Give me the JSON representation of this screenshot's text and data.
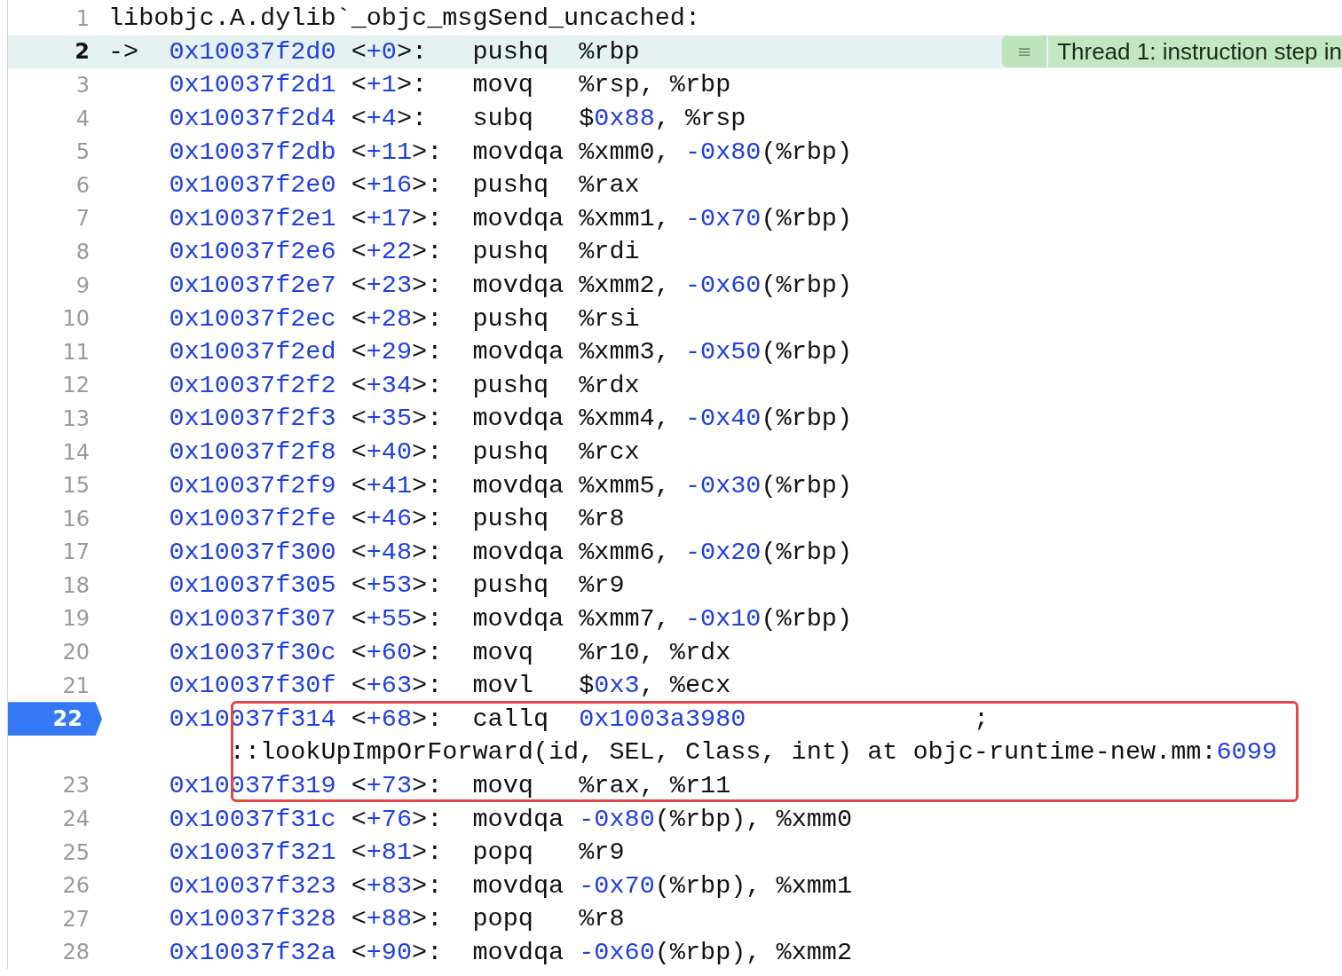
{
  "lines": [
    {
      "number": "1",
      "kind": "header",
      "current": false,
      "breakpoint": false,
      "code": [
        {
          "text": "libobjc.A.dylib`_objc_msgSend_uncached:",
          "kind": "plain"
        }
      ]
    },
    {
      "number": "2",
      "kind": "instruction",
      "current": true,
      "breakpoint": false,
      "arrow": "->",
      "badge": {
        "icon": "≡",
        "text": "Thread 1: instruction step in"
      },
      "code": [
        {
          "text": "0x10037f2d0",
          "kind": "literal"
        },
        {
          "text": " <",
          "kind": "plain"
        },
        {
          "text": "+0",
          "kind": "literal"
        },
        {
          "text": ">:   pushq  %rbp",
          "kind": "plain"
        }
      ]
    },
    {
      "number": "3",
      "kind": "instruction",
      "current": false,
      "breakpoint": false,
      "code": [
        {
          "text": "0x10037f2d1",
          "kind": "literal"
        },
        {
          "text": " <",
          "kind": "plain"
        },
        {
          "text": "+1",
          "kind": "literal"
        },
        {
          "text": ">:   movq   %rsp, %rbp",
          "kind": "plain"
        }
      ]
    },
    {
      "number": "4",
      "kind": "instruction",
      "current": false,
      "breakpoint": false,
      "code": [
        {
          "text": "0x10037f2d4",
          "kind": "literal"
        },
        {
          "text": " <",
          "kind": "plain"
        },
        {
          "text": "+4",
          "kind": "literal"
        },
        {
          "text": ">:   subq   $",
          "kind": "plain"
        },
        {
          "text": "0x88",
          "kind": "literal"
        },
        {
          "text": ", %rsp",
          "kind": "plain"
        }
      ]
    },
    {
      "number": "5",
      "kind": "instruction",
      "current": false,
      "breakpoint": false,
      "code": [
        {
          "text": "0x10037f2db",
          "kind": "literal"
        },
        {
          "text": " <",
          "kind": "plain"
        },
        {
          "text": "+11",
          "kind": "literal"
        },
        {
          "text": ">:  movdqa %xmm0, ",
          "kind": "plain"
        },
        {
          "text": "-0x80",
          "kind": "literal"
        },
        {
          "text": "(%rbp)",
          "kind": "plain"
        }
      ]
    },
    {
      "number": "6",
      "kind": "instruction",
      "current": false,
      "breakpoint": false,
      "code": [
        {
          "text": "0x10037f2e0",
          "kind": "literal"
        },
        {
          "text": " <",
          "kind": "plain"
        },
        {
          "text": "+16",
          "kind": "literal"
        },
        {
          "text": ">:  pushq  %rax",
          "kind": "plain"
        }
      ]
    },
    {
      "number": "7",
      "kind": "instruction",
      "current": false,
      "breakpoint": false,
      "code": [
        {
          "text": "0x10037f2e1",
          "kind": "literal"
        },
        {
          "text": " <",
          "kind": "plain"
        },
        {
          "text": "+17",
          "kind": "literal"
        },
        {
          "text": ">:  movdqa %xmm1, ",
          "kind": "plain"
        },
        {
          "text": "-0x70",
          "kind": "literal"
        },
        {
          "text": "(%rbp)",
          "kind": "plain"
        }
      ]
    },
    {
      "number": "8",
      "kind": "instruction",
      "current": false,
      "breakpoint": false,
      "code": [
        {
          "text": "0x10037f2e6",
          "kind": "literal"
        },
        {
          "text": " <",
          "kind": "plain"
        },
        {
          "text": "+22",
          "kind": "literal"
        },
        {
          "text": ">:  pushq  %rdi",
          "kind": "plain"
        }
      ]
    },
    {
      "number": "9",
      "kind": "instruction",
      "current": false,
      "breakpoint": false,
      "code": [
        {
          "text": "0x10037f2e7",
          "kind": "literal"
        },
        {
          "text": " <",
          "kind": "plain"
        },
        {
          "text": "+23",
          "kind": "literal"
        },
        {
          "text": ">:  movdqa %xmm2, ",
          "kind": "plain"
        },
        {
          "text": "-0x60",
          "kind": "literal"
        },
        {
          "text": "(%rbp)",
          "kind": "plain"
        }
      ]
    },
    {
      "number": "10",
      "kind": "instruction",
      "current": false,
      "breakpoint": false,
      "code": [
        {
          "text": "0x10037f2ec",
          "kind": "literal"
        },
        {
          "text": " <",
          "kind": "plain"
        },
        {
          "text": "+28",
          "kind": "literal"
        },
        {
          "text": ">:  pushq  %rsi",
          "kind": "plain"
        }
      ]
    },
    {
      "number": "11",
      "kind": "instruction",
      "current": false,
      "breakpoint": false,
      "code": [
        {
          "text": "0x10037f2ed",
          "kind": "literal"
        },
        {
          "text": " <",
          "kind": "plain"
        },
        {
          "text": "+29",
          "kind": "literal"
        },
        {
          "text": ">:  movdqa %xmm3, ",
          "kind": "plain"
        },
        {
          "text": "-0x50",
          "kind": "literal"
        },
        {
          "text": "(%rbp)",
          "kind": "plain"
        }
      ]
    },
    {
      "number": "12",
      "kind": "instruction",
      "current": false,
      "breakpoint": false,
      "code": [
        {
          "text": "0x10037f2f2",
          "kind": "literal"
        },
        {
          "text": " <",
          "kind": "plain"
        },
        {
          "text": "+34",
          "kind": "literal"
        },
        {
          "text": ">:  pushq  %rdx",
          "kind": "plain"
        }
      ]
    },
    {
      "number": "13",
      "kind": "instruction",
      "current": false,
      "breakpoint": false,
      "code": [
        {
          "text": "0x10037f2f3",
          "kind": "literal"
        },
        {
          "text": " <",
          "kind": "plain"
        },
        {
          "text": "+35",
          "kind": "literal"
        },
        {
          "text": ">:  movdqa %xmm4, ",
          "kind": "plain"
        },
        {
          "text": "-0x40",
          "kind": "literal"
        },
        {
          "text": "(%rbp)",
          "kind": "plain"
        }
      ]
    },
    {
      "number": "14",
      "kind": "instruction",
      "current": false,
      "breakpoint": false,
      "code": [
        {
          "text": "0x10037f2f8",
          "kind": "literal"
        },
        {
          "text": " <",
          "kind": "plain"
        },
        {
          "text": "+40",
          "kind": "literal"
        },
        {
          "text": ">:  pushq  %rcx",
          "kind": "plain"
        }
      ]
    },
    {
      "number": "15",
      "kind": "instruction",
      "current": false,
      "breakpoint": false,
      "code": [
        {
          "text": "0x10037f2f9",
          "kind": "literal"
        },
        {
          "text": " <",
          "kind": "plain"
        },
        {
          "text": "+41",
          "kind": "literal"
        },
        {
          "text": ">:  movdqa %xmm5, ",
          "kind": "plain"
        },
        {
          "text": "-0x30",
          "kind": "literal"
        },
        {
          "text": "(%rbp)",
          "kind": "plain"
        }
      ]
    },
    {
      "number": "16",
      "kind": "instruction",
      "current": false,
      "breakpoint": false,
      "code": [
        {
          "text": "0x10037f2fe",
          "kind": "literal"
        },
        {
          "text": " <",
          "kind": "plain"
        },
        {
          "text": "+46",
          "kind": "literal"
        },
        {
          "text": ">:  pushq  %r8",
          "kind": "plain"
        }
      ]
    },
    {
      "number": "17",
      "kind": "instruction",
      "current": false,
      "breakpoint": false,
      "code": [
        {
          "text": "0x10037f300",
          "kind": "literal"
        },
        {
          "text": " <",
          "kind": "plain"
        },
        {
          "text": "+48",
          "kind": "literal"
        },
        {
          "text": ">:  movdqa %xmm6, ",
          "kind": "plain"
        },
        {
          "text": "-0x20",
          "kind": "literal"
        },
        {
          "text": "(%rbp)",
          "kind": "plain"
        }
      ]
    },
    {
      "number": "18",
      "kind": "instruction",
      "current": false,
      "breakpoint": false,
      "code": [
        {
          "text": "0x10037f305",
          "kind": "literal"
        },
        {
          "text": " <",
          "kind": "plain"
        },
        {
          "text": "+53",
          "kind": "literal"
        },
        {
          "text": ">:  pushq  %r9",
          "kind": "plain"
        }
      ]
    },
    {
      "number": "19",
      "kind": "instruction",
      "current": false,
      "breakpoint": false,
      "code": [
        {
          "text": "0x10037f307",
          "kind": "literal"
        },
        {
          "text": " <",
          "kind": "plain"
        },
        {
          "text": "+55",
          "kind": "literal"
        },
        {
          "text": ">:  movdqa %xmm7, ",
          "kind": "plain"
        },
        {
          "text": "-0x10",
          "kind": "literal"
        },
        {
          "text": "(%rbp)",
          "kind": "plain"
        }
      ]
    },
    {
      "number": "20",
      "kind": "instruction",
      "current": false,
      "breakpoint": false,
      "code": [
        {
          "text": "0x10037f30c",
          "kind": "literal"
        },
        {
          "text": " <",
          "kind": "plain"
        },
        {
          "text": "+60",
          "kind": "literal"
        },
        {
          "text": ">:  movq   %r10, %rdx",
          "kind": "plain"
        }
      ]
    },
    {
      "number": "21",
      "kind": "instruction",
      "current": false,
      "breakpoint": false,
      "code": [
        {
          "text": "0x10037f30f",
          "kind": "literal"
        },
        {
          "text": " <",
          "kind": "plain"
        },
        {
          "text": "+63",
          "kind": "literal"
        },
        {
          "text": ">:  movl   $",
          "kind": "plain"
        },
        {
          "text": "0x3",
          "kind": "literal"
        },
        {
          "text": ", %ecx",
          "kind": "plain"
        }
      ]
    },
    {
      "number": "22",
      "kind": "instruction",
      "current": false,
      "breakpoint": true,
      "framed": true,
      "code": [
        {
          "text": "0x10037f314",
          "kind": "literal"
        },
        {
          "text": " <",
          "kind": "plain"
        },
        {
          "text": "+68",
          "kind": "literal"
        },
        {
          "text": ">:  callq  ",
          "kind": "plain"
        },
        {
          "text": "0x1003a3980",
          "kind": "literal"
        },
        {
          "text": "               ;",
          "kind": "plain"
        }
      ],
      "wrap": [
        {
          "text": "::lookUpImpOrForward(id, SEL, Class, int) at objc-runtime-new.mm:",
          "kind": "plain"
        },
        {
          "text": "6099",
          "kind": "literal"
        }
      ]
    },
    {
      "number": "23",
      "kind": "instruction",
      "current": false,
      "breakpoint": false,
      "code": [
        {
          "text": "0x10037f319",
          "kind": "literal"
        },
        {
          "text": " <",
          "kind": "plain"
        },
        {
          "text": "+73",
          "kind": "literal"
        },
        {
          "text": ">:  movq   %rax, %r11",
          "kind": "plain"
        }
      ]
    },
    {
      "number": "24",
      "kind": "instruction",
      "current": false,
      "breakpoint": false,
      "code": [
        {
          "text": "0x10037f31c",
          "kind": "literal"
        },
        {
          "text": " <",
          "kind": "plain"
        },
        {
          "text": "+76",
          "kind": "literal"
        },
        {
          "text": ">:  movdqa ",
          "kind": "plain"
        },
        {
          "text": "-0x80",
          "kind": "literal"
        },
        {
          "text": "(%rbp), %xmm0",
          "kind": "plain"
        }
      ]
    },
    {
      "number": "25",
      "kind": "instruction",
      "current": false,
      "breakpoint": false,
      "code": [
        {
          "text": "0x10037f321",
          "kind": "literal"
        },
        {
          "text": " <",
          "kind": "plain"
        },
        {
          "text": "+81",
          "kind": "literal"
        },
        {
          "text": ">:  popq   %r9",
          "kind": "plain"
        }
      ]
    },
    {
      "number": "26",
      "kind": "instruction",
      "current": false,
      "breakpoint": false,
      "code": [
        {
          "text": "0x10037f323",
          "kind": "literal"
        },
        {
          "text": " <",
          "kind": "plain"
        },
        {
          "text": "+83",
          "kind": "literal"
        },
        {
          "text": ">:  movdqa ",
          "kind": "plain"
        },
        {
          "text": "-0x70",
          "kind": "literal"
        },
        {
          "text": "(%rbp), %xmm1",
          "kind": "plain"
        }
      ]
    },
    {
      "number": "27",
      "kind": "instruction",
      "current": false,
      "breakpoint": false,
      "code": [
        {
          "text": "0x10037f328",
          "kind": "literal"
        },
        {
          "text": " <",
          "kind": "plain"
        },
        {
          "text": "+88",
          "kind": "literal"
        },
        {
          "text": ">:  popq   %r8",
          "kind": "plain"
        }
      ]
    },
    {
      "number": "28",
      "kind": "instruction",
      "current": false,
      "breakpoint": false,
      "code": [
        {
          "text": "0x10037f32a",
          "kind": "literal"
        },
        {
          "text": " <",
          "kind": "plain"
        },
        {
          "text": "+90",
          "kind": "literal"
        },
        {
          "text": ">:  movdqa ",
          "kind": "plain"
        },
        {
          "text": "-0x60",
          "kind": "literal"
        },
        {
          "text": "(%rbp), %xmm2",
          "kind": "plain"
        }
      ]
    }
  ]
}
